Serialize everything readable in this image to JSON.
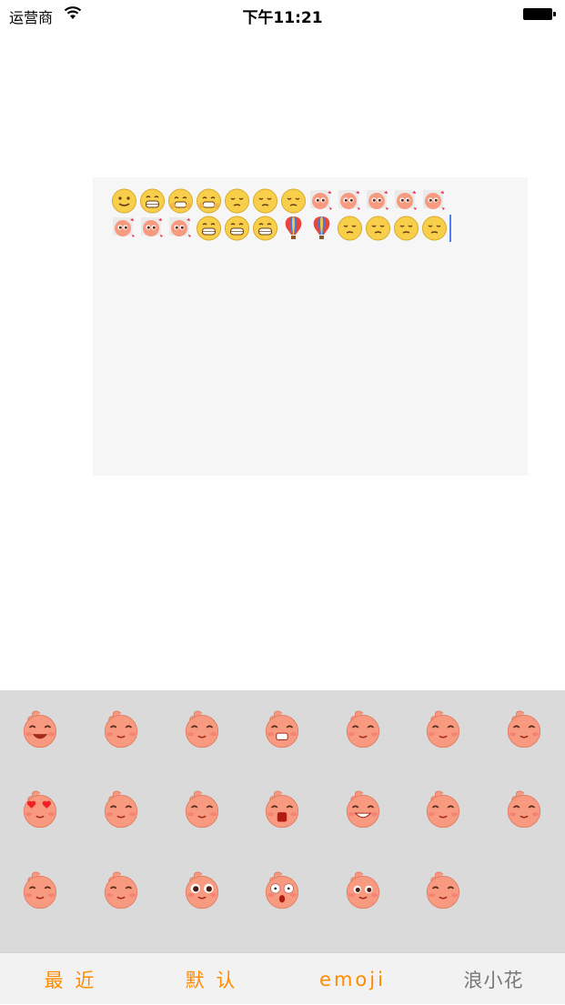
{
  "status_bar": {
    "carrier": "运营商",
    "time": "下午11:21"
  },
  "text_input": {
    "line1": [
      "smile",
      "grin",
      "laugh",
      "laugh",
      "pensive",
      "pensive",
      "pensive",
      "sticker",
      "sticker",
      "sticker",
      "sticker",
      "sticker"
    ],
    "line2": [
      "sticker",
      "sticker",
      "sticker",
      "grin",
      "grin",
      "grin",
      "balloon",
      "balloon",
      "pensive",
      "pensive",
      "pensive",
      "pensive"
    ]
  },
  "emoji_panel": {
    "stickers": [
      [
        "laugh-sticker-icon",
        "fan-sticker-icon",
        "blush-sticker-icon",
        "angry-sticker-icon",
        "rage-sticker-icon",
        "smirk-sticker-icon",
        "shy-sticker-icon"
      ],
      [
        "love-sticker-icon",
        "cry-sticker-icon",
        "cute-sticker-icon",
        "scared-sticker-icon",
        "grin-sticker-icon",
        "pout-sticker-icon",
        "doubt-sticker-icon"
      ],
      [
        "sparkle-sticker-icon",
        "sweat-sticker-icon",
        "teary-sticker-icon",
        "shock-sticker-icon",
        "kiss-sticker-icon",
        "squint-sticker-icon"
      ]
    ]
  },
  "tabs": [
    {
      "label": "最 近",
      "active": true
    },
    {
      "label": "默 认",
      "active": true
    },
    {
      "label": "emoji",
      "active": true
    },
    {
      "label": "浪小花",
      "active": false
    }
  ],
  "colors": {
    "accent": "#ff8c00",
    "keyboard_bg": "#dadada",
    "sticker_skin": "#f79a80"
  }
}
